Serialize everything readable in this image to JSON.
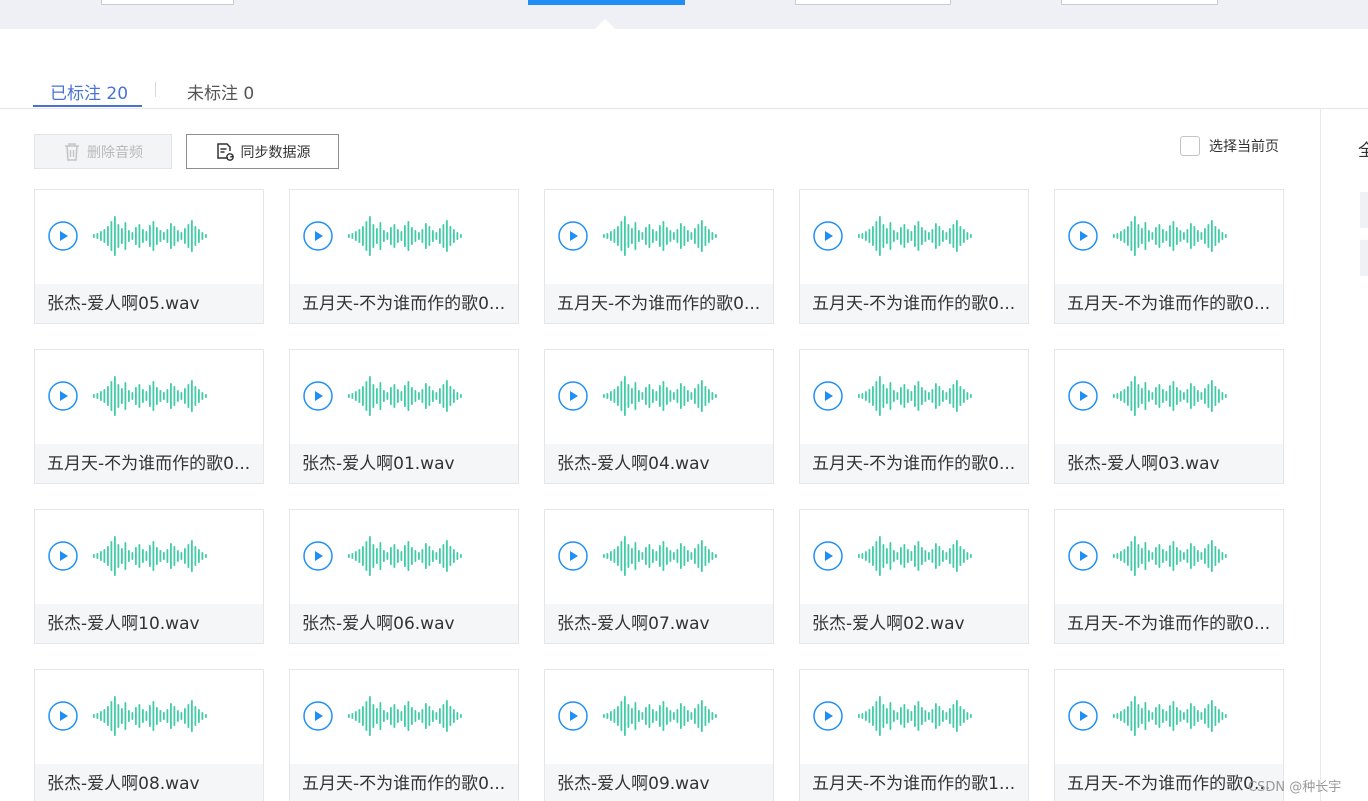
{
  "tabs": [
    {
      "label": "已标注 20",
      "active": true
    },
    {
      "label": "未标注 0",
      "active": false
    }
  ],
  "toolbar": {
    "delete_label": "删除音频",
    "sync_label": "同步数据源",
    "select_page_label": "选择当前页"
  },
  "right_panel": {
    "partial_char": "全"
  },
  "cards": [
    {
      "name": "张杰-爱人啊05.wav"
    },
    {
      "name": "五月天-不为谁而作的歌0..."
    },
    {
      "name": "五月天-不为谁而作的歌0..."
    },
    {
      "name": "五月天-不为谁而作的歌0..."
    },
    {
      "name": "五月天-不为谁而作的歌0..."
    },
    {
      "name": "五月天-不为谁而作的歌0..."
    },
    {
      "name": "张杰-爱人啊01.wav"
    },
    {
      "name": "张杰-爱人啊04.wav"
    },
    {
      "name": "五月天-不为谁而作的歌0..."
    },
    {
      "name": "张杰-爱人啊03.wav"
    },
    {
      "name": "张杰-爱人啊10.wav"
    },
    {
      "name": "张杰-爱人啊06.wav"
    },
    {
      "name": "张杰-爱人啊07.wav"
    },
    {
      "name": "张杰-爱人啊02.wav"
    },
    {
      "name": "五月天-不为谁而作的歌0..."
    },
    {
      "name": "张杰-爱人啊08.wav"
    },
    {
      "name": "五月天-不为谁而作的歌0..."
    },
    {
      "name": "张杰-爱人啊09.wav"
    },
    {
      "name": "五月天-不为谁而作的歌1..."
    },
    {
      "name": "五月天-不为谁而作的歌0..."
    }
  ],
  "watermark": "CSDN @种长宇",
  "colors": {
    "accent": "#4a72d6",
    "play": "#1f8ff5",
    "wave": "#3fcca6"
  },
  "icons": {
    "play": "play-circle-icon",
    "waveform": "waveform-icon",
    "delete": "trash-icon",
    "sync": "sync-document-icon"
  }
}
